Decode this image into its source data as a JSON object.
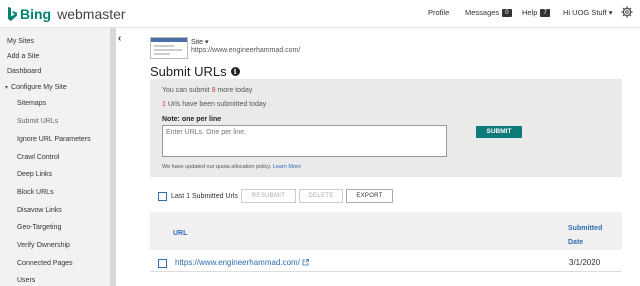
{
  "header": {
    "brand": "Bing",
    "product": "webmaster",
    "profile": "Profile",
    "messages": "Messages",
    "messages_count": "0",
    "help": "Help",
    "help_count": "7",
    "user": "Hi UOG Stuff ▾",
    "icons": [
      "bing-logo-icon",
      "gear-icon"
    ]
  },
  "sidebar": {
    "items": [
      {
        "label": "My Sites"
      },
      {
        "label": "Add a Site"
      },
      {
        "label": "Dashboard"
      },
      {
        "label": "Configure My Site"
      },
      {
        "label": "Sitemaps"
      },
      {
        "label": "Submit URLs"
      },
      {
        "label": "Ignore URL Parameters"
      },
      {
        "label": "Crawl Control"
      },
      {
        "label": "Deep Links"
      },
      {
        "label": "Block URLs"
      },
      {
        "label": "Disavow Links"
      },
      {
        "label": "Geo-Targeting"
      },
      {
        "label": "Verify Ownership"
      },
      {
        "label": "Connected Pages"
      },
      {
        "label": "Users"
      }
    ],
    "collapse_glyph": "‹"
  },
  "site": {
    "label": "Site ▾",
    "url": "https://www.engineerhammad.com/"
  },
  "page": {
    "title": "Submit URLs",
    "info_glyph": "i"
  },
  "panel": {
    "quota_prefix": "You can submit ",
    "quota_count": "9",
    "quota_suffix": " more today",
    "submitted_count": "1",
    "submitted_suffix": " Urls have been submitted today",
    "note": "Note: one per line",
    "textarea_placeholder": "Enter URLs. One per line.",
    "submit_label": "SUBMIT",
    "quota_note": "We have updated our quota allocation policy. ",
    "learn_more": "Learn More"
  },
  "actions": {
    "last_label": "Last 1 Submitted Urls",
    "resubmit": "RESUBMIT",
    "delete": "DELETE",
    "export": "EXPORT"
  },
  "table": {
    "col_url": "URL",
    "col_submitted": "Submitted",
    "col_date": "Date",
    "rows": [
      {
        "url": "https://www.engineerhammad.com/",
        "date": "3/1/2020"
      }
    ]
  },
  "colors": {
    "brand": "#008373",
    "submit": "#0f7a7a",
    "link": "#2e6db4",
    "accent_red": "#c0392b"
  }
}
